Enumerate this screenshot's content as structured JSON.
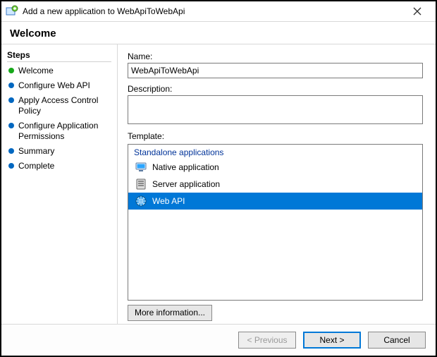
{
  "titlebar": {
    "title": "Add a new application to WebApiToWebApi"
  },
  "page": {
    "heading": "Welcome"
  },
  "sidebar": {
    "title": "Steps",
    "items": [
      {
        "label": "Welcome",
        "current": true
      },
      {
        "label": "Configure Web API"
      },
      {
        "label": "Apply Access Control Policy"
      },
      {
        "label": "Configure Application Permissions"
      },
      {
        "label": "Summary"
      },
      {
        "label": "Complete"
      }
    ]
  },
  "form": {
    "name_label": "Name:",
    "name_value": "WebApiToWebApi",
    "description_label": "Description:",
    "description_value": "",
    "template_label": "Template:",
    "template_group": "Standalone applications",
    "templates": [
      {
        "label": "Native application",
        "selected": false
      },
      {
        "label": "Server application",
        "selected": false
      },
      {
        "label": "Web API",
        "selected": true
      }
    ],
    "more_info_label": "More information..."
  },
  "footer": {
    "previous": "< Previous",
    "next": "Next >",
    "cancel": "Cancel"
  }
}
